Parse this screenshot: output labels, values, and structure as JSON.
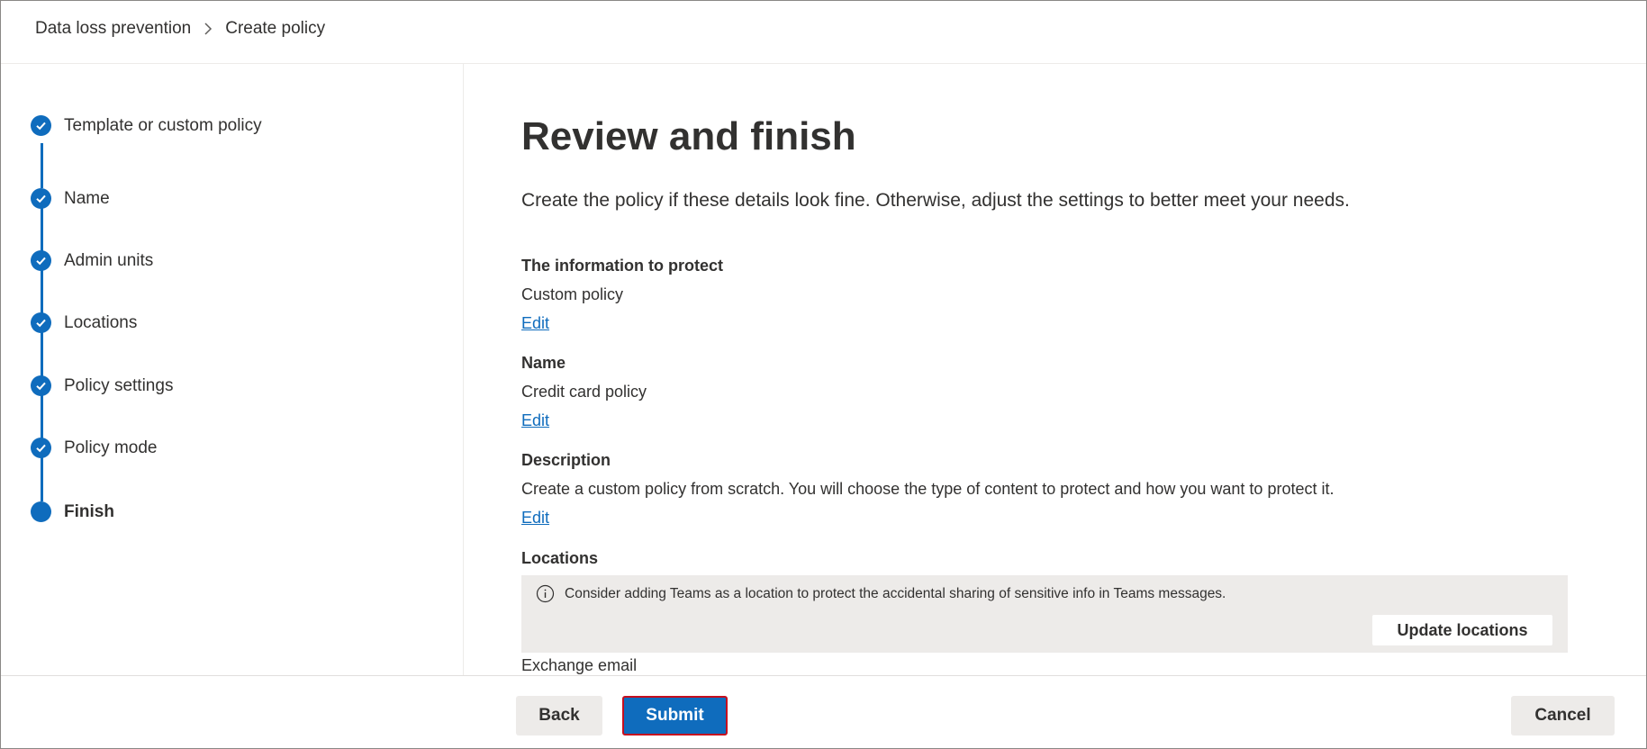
{
  "breadcrumb": {
    "items": [
      "Data loss prevention",
      "Create policy"
    ]
  },
  "wizard": {
    "steps": [
      {
        "label": "Template or custom policy",
        "status": "completed"
      },
      {
        "label": "Name",
        "status": "completed"
      },
      {
        "label": "Admin units",
        "status": "completed"
      },
      {
        "label": "Locations",
        "status": "completed"
      },
      {
        "label": "Policy settings",
        "status": "completed"
      },
      {
        "label": "Policy mode",
        "status": "completed"
      },
      {
        "label": "Finish",
        "status": "current"
      }
    ]
  },
  "main": {
    "title": "Review and finish",
    "intro": "Create the policy if these details look fine. Otherwise, adjust the settings to better meet your needs.",
    "sections": [
      {
        "heading": "The information to protect",
        "value": "Custom policy",
        "edit_label": "Edit"
      },
      {
        "heading": "Name",
        "value": "Credit card policy",
        "edit_label": "Edit"
      },
      {
        "heading": "Description",
        "value": "Create a custom policy from scratch. You will choose the type of content to protect and how you want to protect it.",
        "edit_label": "Edit"
      }
    ],
    "locations": {
      "heading": "Locations",
      "info_message": "Consider adding Teams as a location to protect the accidental sharing of sensitive info in Teams messages.",
      "update_button": "Update locations",
      "first_location": "Exchange email"
    }
  },
  "footer": {
    "back_label": "Back",
    "submit_label": "Submit",
    "cancel_label": "Cancel"
  },
  "colors": {
    "accent": "#0f6cbd",
    "focus_outline": "#c50f1f",
    "info_bar_bg": "#edebe9"
  },
  "icons": {
    "step_completed": "checkmark-icon",
    "step_current": "filled-circle-icon",
    "breadcrumb_separator": "chevron-right-icon",
    "info": "info-icon"
  }
}
